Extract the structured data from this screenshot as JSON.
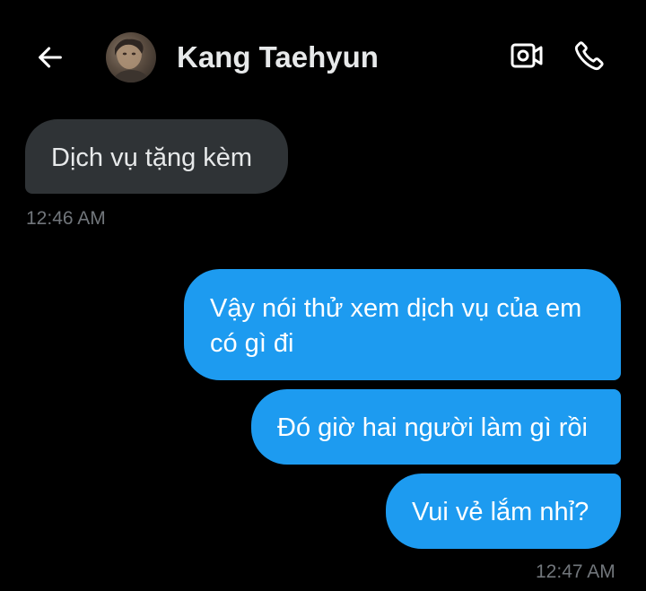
{
  "header": {
    "contact_name": "Kang Taehyun",
    "back_icon": "arrow-left-icon",
    "video_icon": "video-camera-icon",
    "call_icon": "phone-icon"
  },
  "messages": [
    {
      "direction": "received",
      "text": "Dịch vụ tặng kèm"
    },
    {
      "direction": "sent",
      "line1": "Vậy nói thử xem dịch vụ của em",
      "line2": "có gì đi"
    },
    {
      "direction": "sent",
      "text": "Đó giờ hai người làm gì rồi"
    },
    {
      "direction": "sent",
      "text": "Vui vẻ lắm nhỉ?"
    }
  ],
  "timestamps": {
    "received": "12:46 AM",
    "sent": "12:47 AM"
  },
  "colors": {
    "background": "#000000",
    "received_bubble": "#2f3336",
    "sent_bubble": "#1d9bf0",
    "timestamp_text": "#71767b",
    "primary_text": "#e7e9ea"
  }
}
